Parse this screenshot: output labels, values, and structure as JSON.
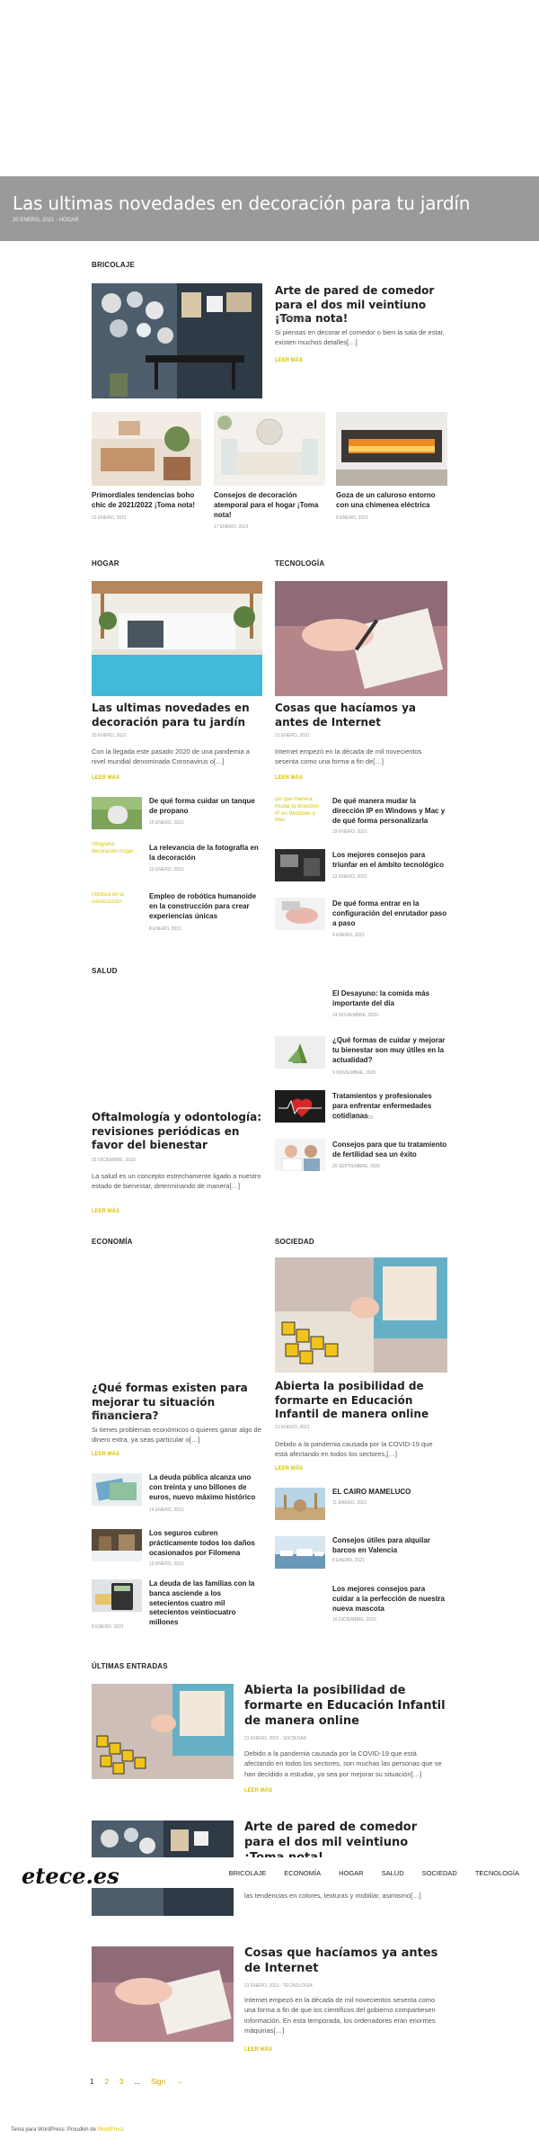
{
  "hero": {
    "title": "Las ultimas novedades en decoración para tu jardín",
    "meta": "20 ENERO, 2021 - HOGAR"
  },
  "sections": {
    "bricolaje": "BRICOLAJE",
    "hogar": "HOGAR",
    "tecnologia": "TECNOLOGÍA",
    "salud": "SALUD",
    "economia": "ECONOMÍA",
    "sociedad": "SOCIEDAD",
    "ultimas": "ÚLTIMAS ENTRADAS"
  },
  "bricolaje": {
    "main": {
      "title": "Arte de pared de comedor para el dos mil veintiuno ¡Toma nota!",
      "date": "20 ENERO, 2021",
      "excerpt": "Si piensas en decorar el comedor o bien la sala de estar, existen muchos detalles[…]",
      "more": "LEER MÁS"
    },
    "small": [
      {
        "title": "Primordiales tendencias boho chic de 2021/2022 ¡Toma nota!",
        "date": "19 ENERO, 2021"
      },
      {
        "title": "Consejos de decoración atemporal para el hogar ¡Toma nota!",
        "date": "17 ENERO, 2021"
      },
      {
        "title": "Goza de un caluroso entorno con una chimenea eléctrica",
        "date": "8 ENERO, 2021"
      }
    ]
  },
  "hogar": {
    "main": {
      "title": "Las ultimas novedades en decoración para tu jardín",
      "date": "20 ENERO, 2021",
      "excerpt": "Con la llegada este pasado 2020 de una pandemia a nivel mundial denominada Coronavirus o[…]",
      "more": "LEER MÁS"
    },
    "list": [
      {
        "thumb": "",
        "title": "De qué forma cuidar un tanque de propano",
        "date": "15 ENERO, 2021"
      },
      {
        "thumb": "fotografía decoración hogar",
        "title": "La relevancia de la fotografía en la decoración",
        "date": "13 ENERO, 2021"
      },
      {
        "thumb": "robótica en la construcción",
        "title": "Empleo de robótica humanoide en la construcción para crear experiencias únicas",
        "date": "8 ENERO, 2021"
      }
    ]
  },
  "tecnologia": {
    "main": {
      "title": "Cosas que hacíamos ya antes de Internet",
      "date": "21 ENERO, 2021",
      "excerpt": "Internet empezó en la década de mil novecientos sesenta como una forma a fin de[…]",
      "more": "LEER MÁS"
    },
    "list": [
      {
        "thumb": "De qué manera mudar la dirección IP en Windows y Mac",
        "title": "De qué manera mudar la dirección IP en Windows y Mac y de qué forma personalizarla",
        "date": "19 ENERO, 2021"
      },
      {
        "thumb": "",
        "title": "Los mejores consejos para triunfar en el ámbito tecnológico",
        "date": "12 ENERO, 2021"
      },
      {
        "thumb": "",
        "title": "De qué forma entrar en la configuración del enrutador paso a paso",
        "date": "9 ENERO, 2021"
      }
    ]
  },
  "salud": {
    "main": {
      "title": "Oftalmología y odontología: revisiones periódicas en favor del bienestar",
      "date": "15 DICIEMBRE, 2020",
      "excerpt": "La salud es un concepto estrechamente ligado a nuestro estado de bienestar, determinando de manera[…]",
      "more": "LEER MÁS"
    },
    "list": [
      {
        "title": "El Desayuno: la comida más importante del día",
        "date": "24 NOVIEMBRE, 2020"
      },
      {
        "title": "¿Qué formas de cuidar y mejorar tu bienestar son muy útiles en la actualidad?",
        "date": "9 NOVIEMBRE, 2020"
      },
      {
        "title": "Tratamientos y profesionales para enfrentar enfermedades cotidianas",
        "date": "19 OCTUBRE, 2020"
      },
      {
        "title": "Consejos para que tu tratamiento de fertilidad sea un éxito",
        "date": "29 SEPTIEMBRE, 2020"
      }
    ]
  },
  "economia": {
    "main": {
      "title": "¿Qué formas existen para mejorar tu situación financiera?",
      "date": "19 ENERO, 2021",
      "excerpt": "Si tienes problemas económicos o quieres ganar algo de dinero extra, ya seas particular o[…]",
      "more": "LEER MÁS"
    },
    "list": [
      {
        "title": "La deuda pública alcanza uno con treinta y uno billones de euros, nuevo máximo histórico",
        "date": "14 ENERO, 2021"
      },
      {
        "title": "Los seguros cubren prácticamente todos los daños ocasionados por Filomena",
        "date": "13 ENERO, 2021"
      },
      {
        "title": "La deuda de las familias con la banca asciende a los setecientos cuatro mil setecientos veintiocuatro millones",
        "date": "8 ENERO, 2021"
      }
    ]
  },
  "sociedad": {
    "main": {
      "title": "Abierta la posibilidad de formarte en Educación Infantil de manera online",
      "date": "21 ENERO, 2021",
      "excerpt": "Debido a la pandemia causada por la COVID-19 que está afectando en todos los sectores,[…]",
      "more": "LEER MÁS"
    },
    "list": [
      {
        "title": "EL CAIRO MAMELUCO",
        "date": "11 ENERO, 2021"
      },
      {
        "title": "Consejos útiles para alquilar barcos en Valencia",
        "date": "8 ENERO, 2021"
      },
      {
        "title": "Los mejores consejos para cuidar a la perfección de nuestra nueva mascota",
        "date": "16 DICIEMBRE, 2020"
      }
    ]
  },
  "ultimas": [
    {
      "title": "Abierta la posibilidad de formarte en Educación Infantil de manera online",
      "meta": "21 ENERO, 2021 - SOCIEDAD",
      "excerpt": "Debido a la pandemia causada por la COVID-19 que está afectando en todos los sectores, son muchas las personas que se han decidido a estudiar, ya sea por mejorar su situación[…]",
      "more": "LEER MÁS"
    },
    {
      "title": "Arte de pared de comedor para el dos mil veintiuno ¡Toma nota!",
      "meta": "",
      "excerpt": "las tendencias en colores, texturas y mobiliar, asimismo[…]",
      "more": ""
    },
    {
      "title": "Cosas que hacíamos ya antes de Internet",
      "meta": "21 ENERO, 2021 - TECNOLOGÍA",
      "excerpt": "Internet empezó en la década de mil novecientos sesenta como una forma a fin de que los científicos del gobierno compartiesen información. En esta temporada, los ordenadores eran enormes máquinas[…]",
      "more": "LEER MÁS"
    }
  ],
  "pagination": {
    "p1": "1",
    "p2": "2",
    "p3": "3",
    "dots": "...",
    "last": "Sign",
    "next": "→"
  },
  "nav": {
    "logo": "etece.es",
    "items": [
      "BRICOLAJE",
      "ECONOMÍA",
      "HOGAR",
      "SALUD",
      "SOCIEDAD",
      "TECNOLOGÍA"
    ]
  },
  "footer": {
    "text": "Tema para WordPress: Proudkin de",
    "link": "WordPress"
  }
}
